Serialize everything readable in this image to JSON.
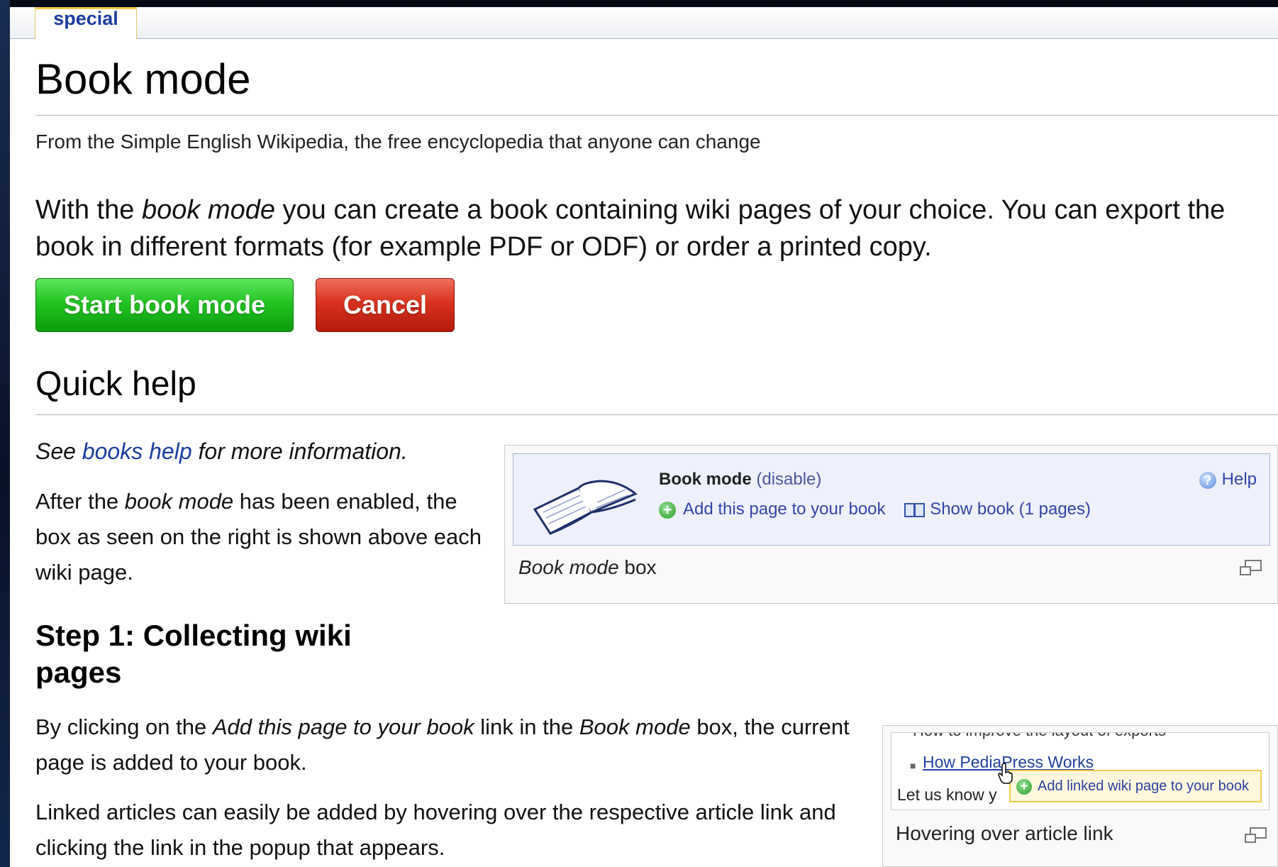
{
  "tab": {
    "label": "special"
  },
  "page": {
    "title": "Book mode",
    "subtitle": "From the Simple English Wikipedia, the free encyclopedia that anyone can change",
    "intro": {
      "part1": "With the ",
      "em": "book mode",
      "part2": " you can create a book containing wiki pages of your choice. You can export the book in different formats (for example PDF or ODF) or order a printed copy."
    }
  },
  "buttons": {
    "start": "Start book mode",
    "cancel": "Cancel"
  },
  "quick_help": {
    "heading": "Quick help",
    "see": "See ",
    "see_link": "books help",
    "see_after": " for more information.",
    "after_1": "After the ",
    "after_em": "book mode",
    "after_2": " has been enabled, the box as seen on the right is shown above each wiki page."
  },
  "step1": {
    "heading": "Step 1: Collecting wiki pages",
    "p1_a": "By clicking on the ",
    "p1_em1": "Add this page to your book",
    "p1_b": " link in the ",
    "p1_em2": "Book mode",
    "p1_c": " box, the current page is added to your book.",
    "p2": "Linked articles can easily be added by hovering over the respective article link and clicking the link in the popup that appears."
  },
  "thumb1": {
    "box_title": "Book mode",
    "box_disable": "(disable)",
    "add_link": "Add this page to your book",
    "show_link": "Show book (1 pages)",
    "help": "Help",
    "caption_em": "Book mode",
    "caption_rest": " box"
  },
  "thumb2": {
    "cut_text": "How to improve the layout of exports",
    "link": "How PediaPress Works",
    "letus": "Let us know y",
    "popup": "Add linked wiki page to your book",
    "caption": "Hovering over article link"
  },
  "icons": [
    "book-illustration-icon",
    "add-icon",
    "book-icon",
    "help-icon",
    "magnify-icon",
    "hand-cursor-icon"
  ],
  "colors": {
    "link": "#1a3ea0",
    "start_button": "#22c322",
    "cancel_button": "#d7321e",
    "tab_accent": "#f2c94c"
  }
}
